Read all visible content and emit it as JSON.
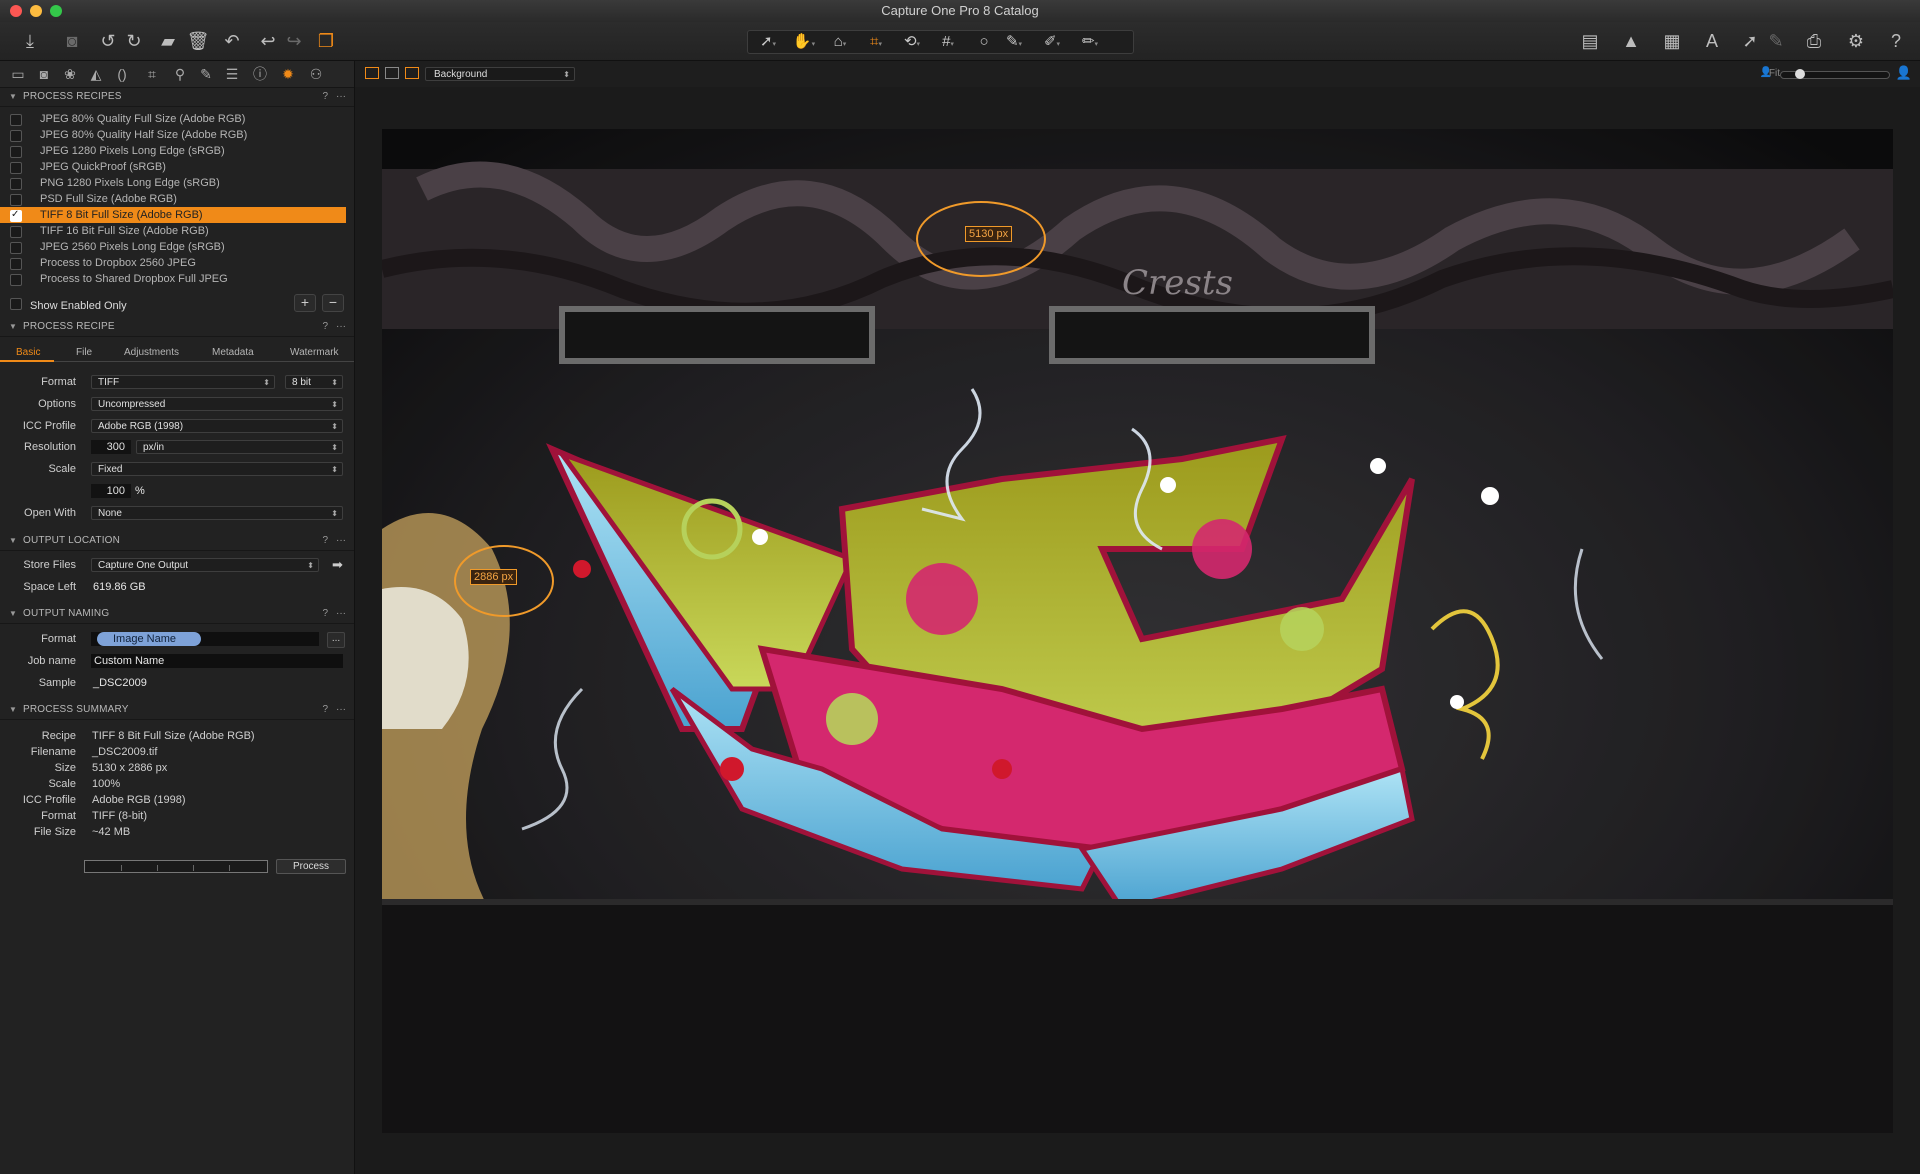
{
  "window": {
    "title": "Capture One Pro 8 Catalog"
  },
  "process_recipes": {
    "header": "PROCESS RECIPES",
    "help": "?",
    "more": "···",
    "items": [
      {
        "label": "JPEG 80% Quality Full Size (Adobe RGB)",
        "checked": false
      },
      {
        "label": "JPEG 80% Quality Half Size (Adobe RGB)",
        "checked": false
      },
      {
        "label": "JPEG 1280 Pixels Long Edge (sRGB)",
        "checked": false
      },
      {
        "label": "JPEG QuickProof (sRGB)",
        "checked": false
      },
      {
        "label": "PNG 1280 Pixels Long Edge (sRGB)",
        "checked": false
      },
      {
        "label": "PSD Full Size (Adobe RGB)",
        "checked": false
      },
      {
        "label": "TIFF 8 Bit Full Size (Adobe RGB)",
        "checked": true
      },
      {
        "label": "TIFF 16 Bit Full Size (Adobe RGB)",
        "checked": false
      },
      {
        "label": "JPEG 2560 Pixels Long Edge (sRGB)",
        "checked": false
      },
      {
        "label": "Process to Dropbox 2560 JPEG",
        "checked": false
      },
      {
        "label": "Process to Shared Dropbox Full JPEG",
        "checked": false
      }
    ],
    "show_enabled_only": "Show Enabled Only",
    "add": "+",
    "remove": "−"
  },
  "process_recipe": {
    "header": "PROCESS RECIPE",
    "tabs": [
      "Basic",
      "File",
      "Adjustments",
      "Metadata",
      "Watermark"
    ],
    "active_tab": "Basic",
    "format_label": "Format",
    "format_value": "TIFF",
    "bit_value": "8 bit",
    "options_label": "Options",
    "options_value": "Uncompressed",
    "icc_label": "ICC Profile",
    "icc_value": "Adobe RGB (1998)",
    "resolution_label": "Resolution",
    "resolution_value": "300",
    "resolution_unit": "px/in",
    "scale_label": "Scale",
    "scale_value": "Fixed",
    "scale_percent": "100",
    "percent_sign": "%",
    "open_with_label": "Open With",
    "open_with_value": "None"
  },
  "output_location": {
    "header": "OUTPUT LOCATION",
    "store_files_label": "Store Files",
    "store_files_value": "Capture One Output",
    "space_left_label": "Space Left",
    "space_left_value": "619.86 GB"
  },
  "output_naming": {
    "header": "OUTPUT NAMING",
    "format_label": "Format",
    "format_token": "Image Name",
    "job_name_label": "Job name",
    "job_name_value": "Custom Name",
    "sample_label": "Sample",
    "sample_value": "_DSC2009",
    "more_btn": "..."
  },
  "process_summary": {
    "header": "PROCESS SUMMARY",
    "rows": [
      {
        "k": "Recipe",
        "v": "TIFF 8 Bit Full Size (Adobe RGB)"
      },
      {
        "k": "Filename",
        "v": "_DSC2009.tif"
      },
      {
        "k": "Size",
        "v": "5130 x 2886 px"
      },
      {
        "k": "Scale",
        "v": "100%"
      },
      {
        "k": "ICC Profile",
        "v": "Adobe RGB (1998)"
      },
      {
        "k": "Format",
        "v": "TIFF (8-bit)"
      },
      {
        "k": "File Size",
        "v": "~42 MB"
      }
    ],
    "process_button": "Process"
  },
  "viewer": {
    "background_select": "Background",
    "fit_label": "Fit",
    "width_callout": "5130 px",
    "height_callout": "2886 px",
    "accent_color": "#f08a18"
  }
}
